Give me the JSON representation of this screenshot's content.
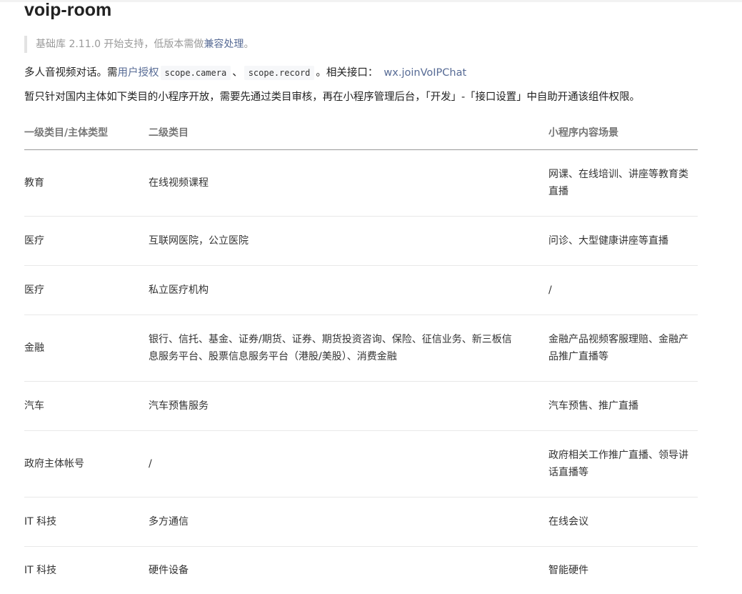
{
  "page": {
    "title": "voip-room"
  },
  "support_note": {
    "prefix": "基础库 2.11.0 开始支持，低版本需做",
    "link": "兼容处理",
    "suffix": "。"
  },
  "intro": {
    "prefix": "多人音视频对话。需",
    "auth_link": "用户授权",
    "scope_camera": "scope.camera",
    "separator": "、",
    "scope_record": "scope.record",
    "related": "。相关接口：",
    "api_link": "wx.joinVoIPChat"
  },
  "scope_text": "暂只针对国内主体如下类目的小程序开放，需要先通过类目审核，再在小程序管理后台，「开发」-「接口设置」中自助开通该组件权限。",
  "table": {
    "headers": [
      "一级类目/主体类型",
      "二级类目",
      "小程序内容场景"
    ],
    "rows": [
      [
        "教育",
        "在线视频课程",
        "网课、在线培训、讲座等教育类直播"
      ],
      [
        "医疗",
        "互联网医院，公立医院",
        "问诊、大型健康讲座等直播"
      ],
      [
        "医疗",
        "私立医疗机构",
        "/"
      ],
      [
        "金融",
        "银行、信托、基金、证券/期货、证券、期货投资咨询、保险、征信业务、新三板信息服务平台、股票信息服务平台（港股/美股）、消费金融",
        "金融产品视频客服理赔、金融产品推广直播等"
      ],
      [
        "汽车",
        "汽车预售服务",
        "汽车预售、推广直播"
      ],
      [
        "政府主体帐号",
        "/",
        "政府相关工作推广直播、领导讲话直播等"
      ],
      [
        "IT 科技",
        "多方通信",
        "在线会议"
      ],
      [
        "IT 科技",
        "硬件设备",
        "智能硬件"
      ]
    ]
  }
}
